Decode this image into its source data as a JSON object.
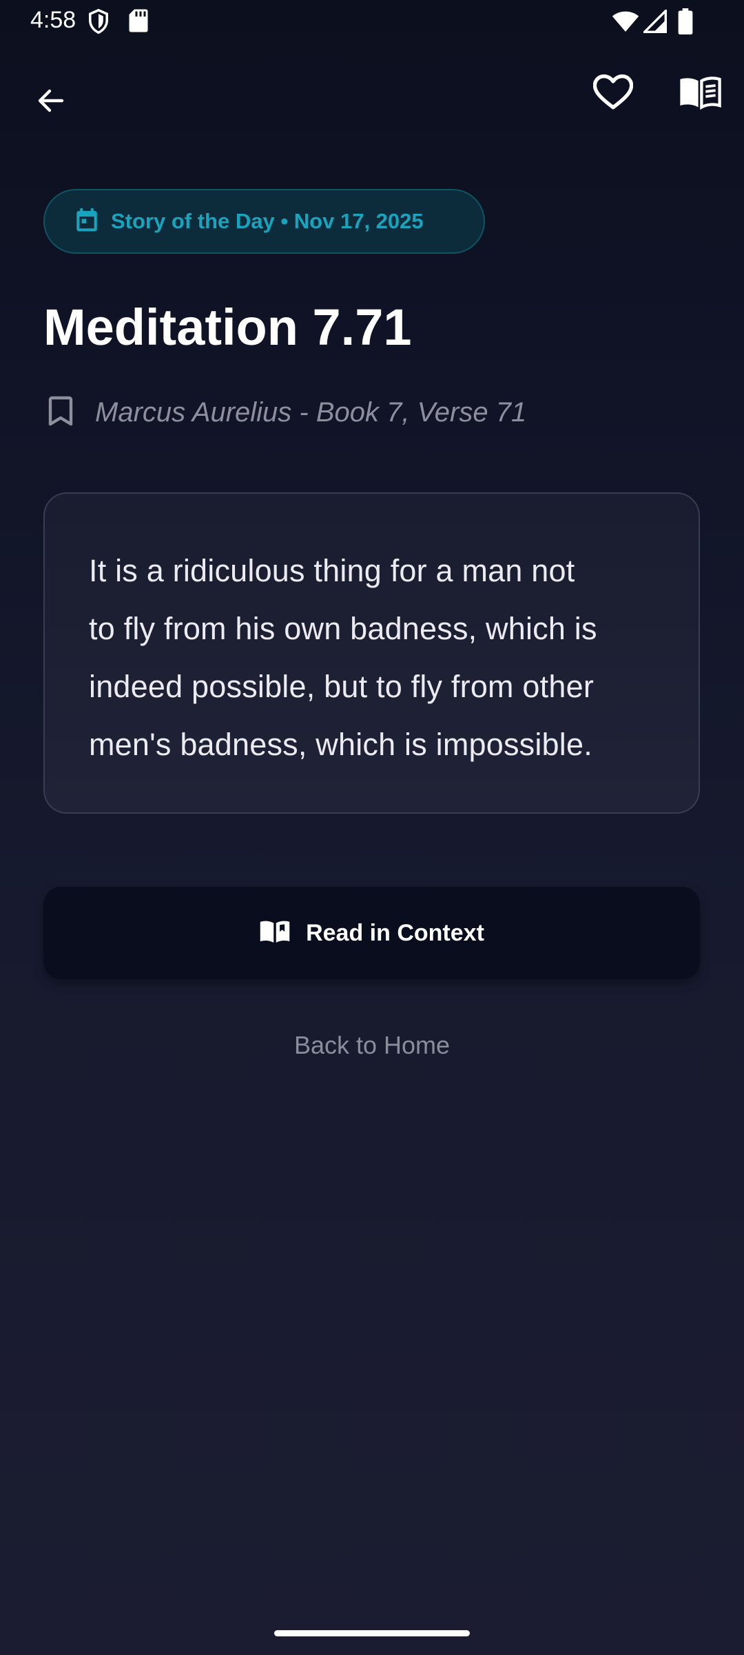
{
  "status_bar": {
    "time": "4:58",
    "icons": [
      "shield-icon",
      "sd-card-icon",
      "wifi-icon",
      "signal-icon",
      "battery-icon"
    ]
  },
  "app_bar": {
    "back_icon": "arrow-back-icon",
    "favorite_icon": "heart-outline-icon",
    "read_icon": "open-book-icon"
  },
  "chip": {
    "icon": "calendar-icon",
    "label": "Story of the Day • Nov 17, 2025"
  },
  "title": "Meditation 7.71",
  "source": {
    "icon": "bookmark-outline-icon",
    "text": "Marcus Aurelius - Book 7, Verse 71"
  },
  "quote": {
    "lines": [
      "It is a ridiculous thing for a man not",
      "to fly from his own badness, which is",
      "indeed possible, but to fly from other",
      "men's badness, which is impossible."
    ]
  },
  "actions": {
    "read_in_context_icon": "open-book-icon",
    "read_in_context_label": "Read in Context",
    "back_home_label": "Back to Home"
  },
  "colors": {
    "accent": "#1aa3bd",
    "chip_background": "#0d2c3b",
    "background_top": "#0b0f1e",
    "background_bottom": "#1b1c31",
    "button_background": "#0a0d1d",
    "muted_text": "#8e8f9d"
  }
}
